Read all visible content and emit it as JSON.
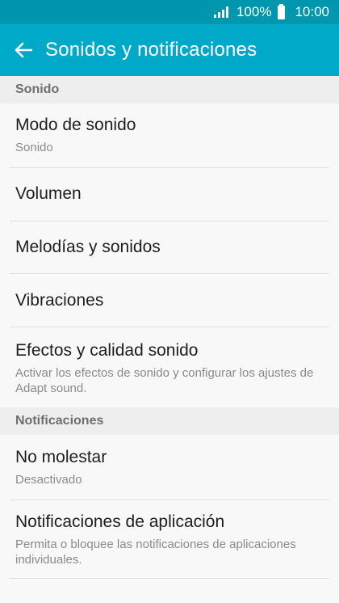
{
  "status_bar": {
    "battery_percent": "100%",
    "time": "10:00",
    "icons": [
      "signal-icon",
      "battery-icon"
    ]
  },
  "app_bar": {
    "back_icon": "back-arrow-icon",
    "title": "Sonidos y notificaciones"
  },
  "sections": {
    "sound": {
      "header": "Sonido",
      "items": [
        {
          "title": "Modo de sonido",
          "subtitle": "Sonido"
        },
        {
          "title": "Volumen"
        },
        {
          "title": "Melodías y sonidos"
        },
        {
          "title": "Vibraciones"
        },
        {
          "title": "Efectos y calidad sonido",
          "subtitle": "Activar los efectos de sonido y configurar los ajustes de Adapt sound."
        }
      ]
    },
    "notifications": {
      "header": "Notificaciones",
      "items": [
        {
          "title": "No molestar",
          "subtitle": "Desactivado"
        },
        {
          "title": "Notificaciones de aplicación",
          "subtitle": "Permita o bloquee las notificaciones de aplicaciones individuales."
        }
      ]
    }
  },
  "colors": {
    "status_bar": "#0096ad",
    "app_bar": "#00a9c7",
    "background": "#f8f8f8",
    "section_header_bg": "#eeeeee"
  }
}
